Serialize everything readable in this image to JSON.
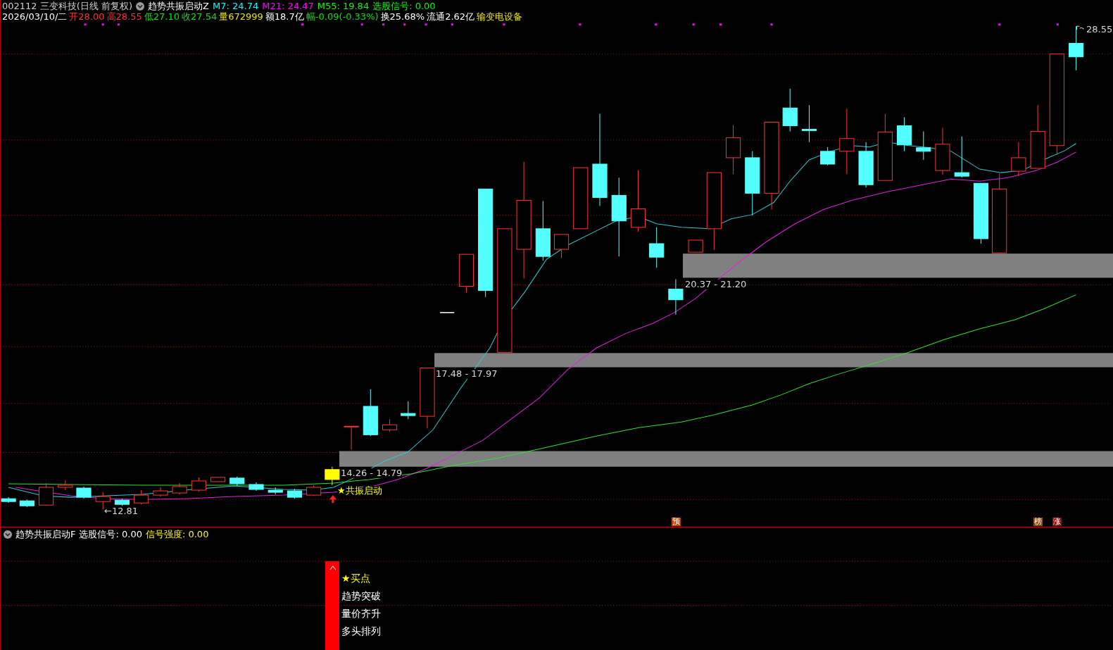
{
  "header": {
    "security": "002112 三变科技(日线 前复权)",
    "indicator": "趋势共振启动Z",
    "values": [
      {
        "text": "M7: 24.74",
        "color": "#00ffff"
      },
      {
        "text": "M21: 24.47",
        "color": "#ff00ff"
      },
      {
        "text": "M55: 19.84",
        "color": "#00ff00"
      },
      {
        "text": "选股信号: 0.00",
        "color": "#00ff00"
      }
    ]
  },
  "quote": [
    {
      "text": "2026/03/10/二",
      "color": "#ffffff"
    },
    {
      "text": "开28.00",
      "color": "#ff3232"
    },
    {
      "text": "高28.55",
      "color": "#ff3232"
    },
    {
      "text": "低27.10",
      "color": "#00e600"
    },
    {
      "text": "收27.54",
      "color": "#00e600"
    },
    {
      "text": "量672999",
      "color": "#e6e600"
    },
    {
      "text": "额18.7亿",
      "color": "#ffffff"
    },
    {
      "text": "幅-0.09(-0.33%)",
      "color": "#00e600"
    },
    {
      "text": "换25.68%",
      "color": "#ffffff"
    },
    {
      "text": "流通2.62亿",
      "color": "#ffffff"
    },
    {
      "text": "输变电设备",
      "color": "#e6e600"
    }
  ],
  "chart": {
    "high_label": "28.55",
    "low_label": "←12.81",
    "signal_label": "★共振启动",
    "zones": [
      {
        "label": "20.37 - 21.20"
      },
      {
        "label": "17.48 - 17.97"
      },
      {
        "label": "14.26 - 14.79"
      }
    ],
    "tags": [
      {
        "text": "预",
        "color": "#c04000"
      },
      {
        "text": "榜",
        "color": "#8a4a10"
      },
      {
        "text": "涨",
        "color": "#8a1010"
      }
    ]
  },
  "lower_panel": {
    "indicator": "趋势共振启动F",
    "values": [
      {
        "text": "选股信号: 0.00",
        "color": "#ffffff"
      },
      {
        "text": "信号强度: 0.00",
        "color": "#ffff00"
      }
    ],
    "signals": [
      {
        "text": "★买点",
        "color": "#ffff00"
      },
      {
        "text": "趋势突破",
        "color": "#ffffff"
      },
      {
        "text": "量价齐升",
        "color": "#ffffff"
      },
      {
        "text": "多头排列",
        "color": "#ffffff"
      }
    ]
  }
}
